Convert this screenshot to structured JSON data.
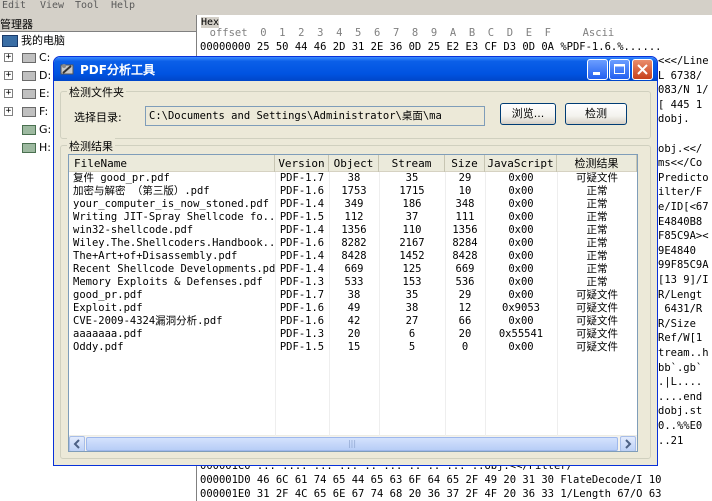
{
  "background_app": {
    "menu": [
      "Edit",
      "View",
      "Tool",
      "Help"
    ],
    "left_panel_title": "管理器",
    "tree": [
      {
        "label": "我的电脑",
        "icon": "computer-icon"
      },
      {
        "label": "C:",
        "icon": "drive-icon"
      },
      {
        "label": "D:",
        "icon": "drive-icon"
      },
      {
        "label": "E:",
        "icon": "drive-icon"
      },
      {
        "label": "F:",
        "icon": "drive-icon"
      },
      {
        "label": "G:",
        "icon": "network-drive-icon"
      },
      {
        "label": "H:",
        "icon": "network-drive-icon"
      }
    ],
    "hex_label": "Hex",
    "hex_header": "  offset  0  1  2  3  4  5  6  7  8  9  A  B  C  D  E  F     Ascii",
    "hex_first_line": "00000000 25 50 44 46 2D 31 2E 36 0D 25 E2 E3 CF D3 0D 0A %PDF-1.6.%......",
    "right_fragments": [
      "<<</Line",
      "L 6738/",
      "083/N 1/",
      "[ 445 1",
      "dobj.",
      "",
      "obj.<</",
      "ms<</Co",
      "Predicto",
      "ilter/F",
      "e/ID[<67",
      "E4840B8",
      "F85C9A><",
      "9E4840",
      "99F85C9A",
      "[13 9]/I",
      "R/Lengt",
      " 6431/R",
      "R/Size ",
      "Ref/W[1",
      "tream..h",
      "bb`.gb`",
      ".|L....",
      "....end",
      "dobj.st",
      "0..%%E0",
      "..21"
    ],
    "hex_bottom_lines": [
      "000001C0 ... .... ... ... .. ... .. .. ... ..obj.<</Filter/",
      "000001D0 46 6C 61 74 65 44 65 63 6F 64 65 2F 49 20 31 30 FlateDecode/I 10",
      "000001E0 31 2F 4C 65 6E 67 74 68 20 36 37 2F 4F 20 36 33 1/Length 67/O 63"
    ]
  },
  "dialog": {
    "title": "PDF分析工具",
    "folder_group_label": "检测文件夹",
    "select_dir_label": "选择目录:",
    "path_value": "C:\\Documents and Settings\\Administrator\\桌面\\ma",
    "browse_label": "浏览...",
    "detect_label": "检测",
    "results_group_label": "检测结果",
    "columns": [
      "FileName",
      "Version",
      "Object",
      "Stream",
      "Size",
      "JavaScript",
      "检测结果"
    ],
    "rows": [
      [
        "复件 good_pr.pdf",
        "PDF-1.7",
        "38",
        "35",
        "29",
        "0x00",
        "可疑文件"
      ],
      [
        "加密与解密 （第三版）.pdf",
        "PDF-1.6",
        "1753",
        "1715",
        "10",
        "0x00",
        "正常"
      ],
      [
        "your_computer_is_now_stoned.pdf",
        "PDF-1.4",
        "349",
        "186",
        "348",
        "0x00",
        "正常"
      ],
      [
        "Writing JIT-Spray Shellcode fo...",
        "PDF-1.5",
        "112",
        "37",
        "111",
        "0x00",
        "正常"
      ],
      [
        "win32-shellcode.pdf",
        "PDF-1.4",
        "1356",
        "110",
        "1356",
        "0x00",
        "正常"
      ],
      [
        "Wiley.The.Shellcoders.Handbook...",
        "PDF-1.6",
        "8282",
        "2167",
        "8284",
        "0x00",
        "正常"
      ],
      [
        "The+Art+of+Disassembly.pdf",
        "PDF-1.4",
        "8428",
        "1452",
        "8428",
        "0x00",
        "正常"
      ],
      [
        "Recent Shellcode Developments.pdf",
        "PDF-1.4",
        "669",
        "125",
        "669",
        "0x00",
        "正常"
      ],
      [
        "Memory Exploits & Defenses.pdf",
        "PDF-1.3",
        "533",
        "153",
        "536",
        "0x00",
        "正常"
      ],
      [
        "good_pr.pdf",
        "PDF-1.7",
        "38",
        "35",
        "29",
        "0x00",
        "可疑文件"
      ],
      [
        "Exploit.pdf",
        "PDF-1.6",
        "49",
        "38",
        "12",
        "0x9053",
        "可疑文件"
      ],
      [
        "CVE-2009-4324漏洞分析.pdf",
        "PDF-1.6",
        "42",
        "27",
        "66",
        "0x00",
        "可疑文件"
      ],
      [
        "aaaaaaa.pdf",
        "PDF-1.3",
        "20",
        "6",
        "20",
        "0x55541",
        "可疑文件"
      ],
      [
        "Oddy.pdf",
        "PDF-1.5",
        "15",
        "5",
        "0",
        "0x00",
        "可疑文件"
      ]
    ],
    "scroll_left_icon": "scroll-left-arrow-icon",
    "scroll_right_icon": "scroll-right-arrow-icon"
  }
}
